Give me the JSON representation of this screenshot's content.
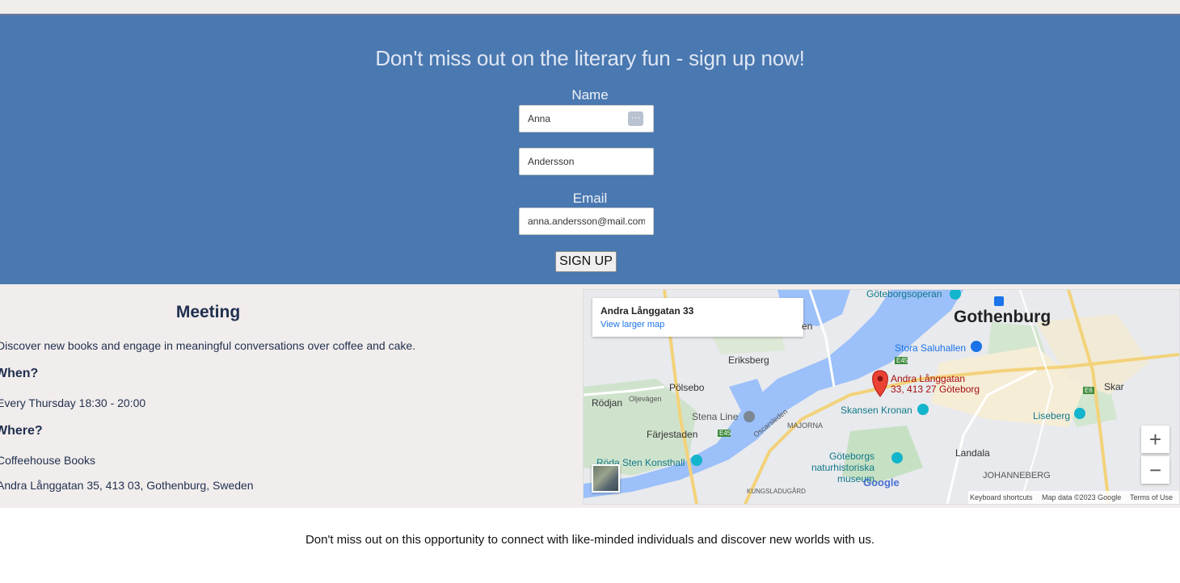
{
  "signup": {
    "heading": "Don't miss out on the literary fun - sign up now!",
    "name_label": "Name",
    "first_name_value": "Anna",
    "last_name_value": "Andersson",
    "email_label": "Email",
    "email_value": "anna.andersson@mail.com",
    "button_label": "SIGN UP"
  },
  "meeting": {
    "title": "Meeting",
    "intro": "Discover new books and engage in meaningful conversations over coffee and cake.",
    "when_heading": "When?",
    "when_text": "Every Thursday 18:30 - 20:00",
    "where_heading": "Where?",
    "venue": "Coffeehouse Books",
    "address": "Andra Långgatan 35, 413 03, Gothenburg, Sweden"
  },
  "map": {
    "card_title": "Andra Långgatan 33",
    "card_link": "View larger map",
    "pin_label_line1": "Andra Långgatan",
    "pin_label_line2": "33, 413 27 Göteborg",
    "city": "Gothenburg",
    "places": {
      "goteborgsoperan": "Göteborgsoperan",
      "eriksberg": "Eriksberg",
      "stora_saluhallen": "Stora Saluhallen",
      "polsebo": "Pölsebo",
      "rodjan": "Rödjan",
      "oljevagen": "Oljevägen",
      "stena_line": "Stena Line",
      "majorna": "MAJORNA",
      "skansen_kronan": "Skansen Kronan",
      "farjestaden": "Färjestaden",
      "oscarsleden": "Oscarsleden",
      "roda_sten": "Röda Sten Konsthall",
      "naturhistoriska": "Göteborgs naturhistoriska museum",
      "kungsladugard": "KUNGSLADUGÅRD",
      "liseberg": "Liseberg",
      "landala": "Landala",
      "johanneberg": "JOHANNEBERG",
      "skar": "Skar",
      "en": "en",
      "e45a": "E45",
      "e45b": "E45",
      "e6": "E6"
    },
    "zoom_in": "+",
    "zoom_out": "−",
    "logo": "Google",
    "footer_shortcuts": "Keyboard shortcuts",
    "footer_data": "Map data ©2023 Google",
    "footer_terms": "Terms of Use"
  },
  "bottom_text": "Don't miss out on this opportunity to connect with like-minded individuals and discover new worlds with us.",
  "colors": {
    "signup_bg": "#4a78b0",
    "meeting_bg": "#f1edec",
    "text_dark": "#1f2f4f"
  }
}
